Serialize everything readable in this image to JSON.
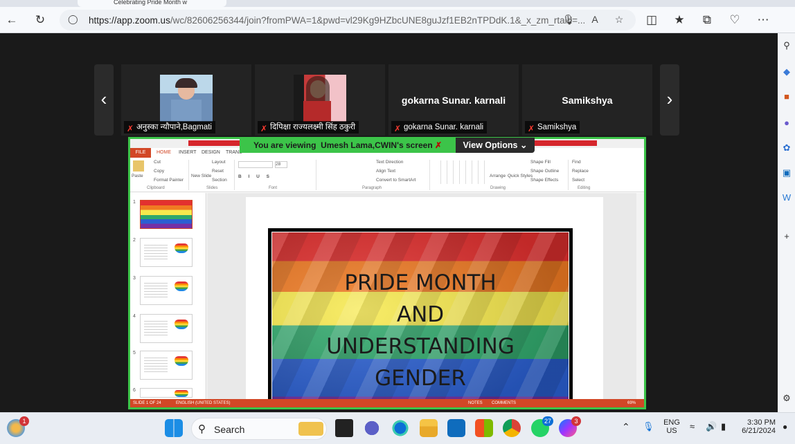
{
  "browser": {
    "tab_title": "Celebrating Pride Month w",
    "url_host": "https://app.zoom.us",
    "url_path": "/wc/82606256344/join?fromPWA=1&pwd=vl29Kg9HZbcUNE8guJzf1EB2nTPDdK.1&_x_zm_rtaid=..."
  },
  "meeting": {
    "participants": [
      {
        "name_label": "अनुस्का न्यौपाने,Bagmati",
        "center_name": "",
        "avatar": "photo"
      },
      {
        "name_label": "दिपिक्षा राज्यलक्ष्मी सिंह ठकुरी",
        "center_name": "",
        "avatar": "photo"
      },
      {
        "name_label": "gokarna Sunar. karnali",
        "center_name": "gokarna Sunar. karnali",
        "avatar": "none"
      },
      {
        "name_label": "Samikshya",
        "center_name": "Samikshya",
        "avatar": "none"
      }
    ],
    "viewing_prefix": "You are viewing",
    "viewing_name": "Umesh Lama,CWIN's screen",
    "view_options_label": "View Options"
  },
  "powerpoint": {
    "tabs": [
      "FILE",
      "HOME",
      "INSERT",
      "DESIGN",
      "TRANS"
    ],
    "ribbon": {
      "clipboard": {
        "paste": "Paste",
        "cut": "Cut",
        "copy": "Copy",
        "format_painter": "Format Painter",
        "group": "Clipboard"
      },
      "slides": {
        "new_slide": "New Slide",
        "layout": "Layout",
        "reset": "Reset",
        "section": "Section",
        "group": "Slides"
      },
      "font": {
        "size": "28",
        "group": "Font"
      },
      "paragraph": {
        "text_direction": "Text Direction",
        "align_text": "Align Text",
        "convert": "Convert to SmartArt",
        "group": "Paragraph"
      },
      "drawing": {
        "arrange": "Arrange",
        "quick_styles": "Quick Styles",
        "shape_fill": "Shape Fill",
        "shape_outline": "Shape Outline",
        "shape_effects": "Shape Effects",
        "group": "Drawing"
      },
      "editing": {
        "find": "Find",
        "replace": "Replace",
        "select": "Select",
        "group": "Editing"
      }
    },
    "thumb_numbers": [
      "1",
      "2",
      "3",
      "4",
      "5",
      "6"
    ],
    "slide_title": "PRIDE MONTH\nAND\nUNDERSTANDING\nGENDER",
    "status": {
      "slide": "SLIDE 1 OF 24",
      "language": "ENGLISH (UNITED STATES)",
      "notes": "NOTES",
      "comments": "COMMENTS",
      "zoom": "69%"
    }
  },
  "taskbar": {
    "search_label": "Search",
    "whatsapp_badge": "27",
    "messenger_badge": "3",
    "start_badge": "1",
    "lang_line1": "ENG",
    "lang_line2": "US",
    "time": "3:30 PM",
    "date": "6/21/2024"
  },
  "colors": {
    "zoom_green": "#3cc449",
    "ppt_orange": "#d24726",
    "edge_blue": "#0c6fd6"
  }
}
